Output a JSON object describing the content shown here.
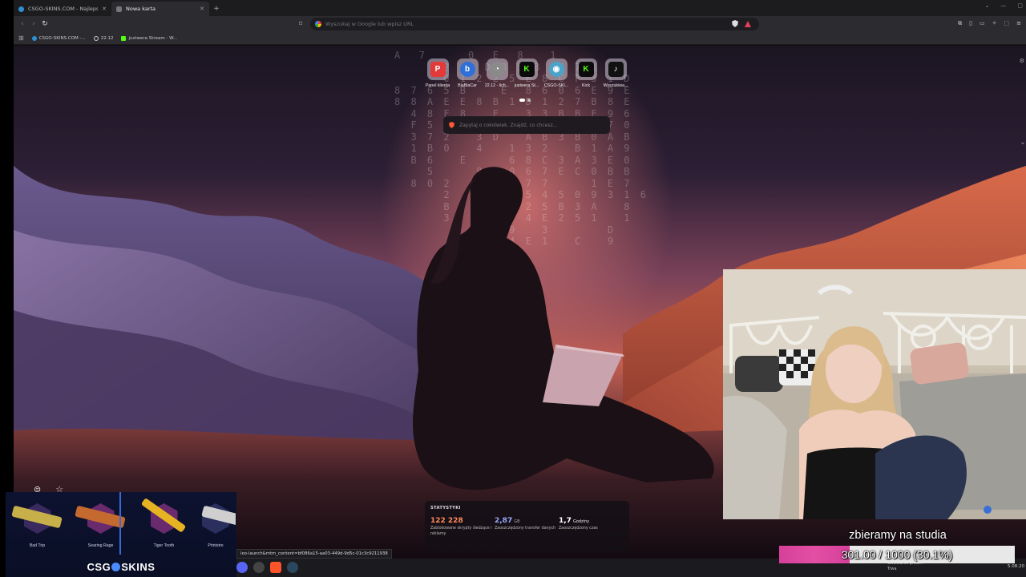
{
  "browser": {
    "tabs": [
      {
        "label": "CSGO-SKINS.COM - Najlepsze Skrzy",
        "active": false
      },
      {
        "label": "Nowa karta",
        "active": true
      }
    ],
    "address_placeholder": "Wyszukaj w Google lub wpisz URL",
    "bookmarks": [
      {
        "label": "CSGO-SKINS.COM -...",
        "icon": "csgo-icon"
      },
      {
        "label": "22.12",
        "icon": "clock-icon"
      },
      {
        "label": "justwera Stream - W...",
        "icon": "kick-icon"
      }
    ]
  },
  "newtab": {
    "top_sites": [
      {
        "label": "Panel klienta",
        "glyph": "P",
        "color": "#e23a3a"
      },
      {
        "label": "BlaBlaCar",
        "glyph": "b",
        "color": "#2f6fd8"
      },
      {
        "label": "22.12 - lich...",
        "glyph": "◔",
        "color": "#8a8a8a"
      },
      {
        "label": "justwera St...",
        "glyph": "K",
        "color": "#53fc18"
      },
      {
        "label": "CSGO-SKI...",
        "glyph": "◉",
        "color": "#4aa3c9"
      },
      {
        "label": "Kick",
        "glyph": "K",
        "color": "#53fc18"
      },
      {
        "label": "Wyszukiwa...",
        "glyph": "♪",
        "color": "#111111"
      }
    ],
    "ask_placeholder": "Zapytaj o cokolwiek. Znajdź, co chcesz...",
    "stats": {
      "title": "STATYSTYKI",
      "items": [
        {
          "value": "122 228",
          "unit": "",
          "caption": "Zablokowane skrypty śledzące i reklamy",
          "color": "#ff8a5c"
        },
        {
          "value": "2,87",
          "unit": "GB",
          "caption": "Zaoszczędzony transfer danych",
          "color": "#9aa8ff"
        },
        {
          "value": "1,7",
          "unit": "Godziny",
          "caption": "Zaoszczędzony czas",
          "color": "#ffffff"
        }
      ]
    },
    "status_url": "leo-launch&mtm_content=bf086a15-aa03-449d-9d5c-01c3c9211938"
  },
  "skins_overlay": {
    "items": [
      {
        "name": "Bad Trip",
        "hex": "#3a2a5e",
        "gun": "#c7b04a"
      },
      {
        "name": "Searing Rage",
        "hex": "#6a2a6e",
        "gun": "#c46a2e"
      },
      {
        "name": "Tiger Tooth",
        "hex": "#6a2a6e",
        "gun": "#e6b422"
      },
      {
        "name": "Printstre",
        "hex": "#2a2f5e",
        "gun": "#cfcfcf"
      }
    ],
    "logo_left": "CSG",
    "logo_right": "SKINS"
  },
  "taskbar": {
    "notif_line1": "Odwołanie przel...",
    "notif_line2": "Trwa",
    "time": "5.08.20"
  },
  "goal": {
    "title": "zbieramy na studia",
    "progress_text": "301.00 / 1000 (30.1%)",
    "fraction": 0.301
  }
}
